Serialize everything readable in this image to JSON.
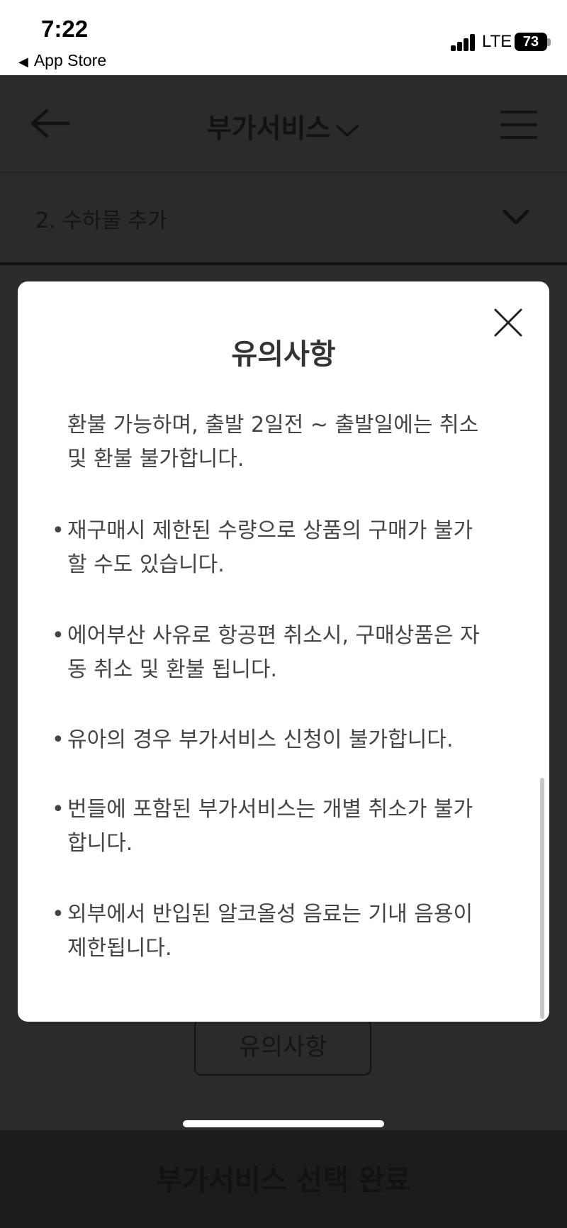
{
  "status_bar": {
    "time": "7:22",
    "back_app": "App Store",
    "network": "LTE",
    "battery": "73"
  },
  "header": {
    "title": "부가서비스"
  },
  "section": {
    "label": "2. 수하물 추가"
  },
  "modal": {
    "title": "유의사항",
    "intro_lines": [
      "환불 가능하며, 출발 2일전 ~ 출발일에는 취소",
      "및 환불 불가합니다."
    ],
    "items": [
      {
        "lines": [
          "재구매시 제한된 수량으로 상품의 구매가 불가",
          "할 수도 있습니다."
        ]
      },
      {
        "lines": [
          "에어부산 사유로 항공편 취소시, 구매상품은 자",
          "동 취소 및 환불 됩니다."
        ]
      },
      {
        "lines": [
          "유아의 경우 부가서비스 신청이 불가합니다."
        ]
      },
      {
        "lines": [
          "번들에 포함된 부가서비스는 개별 취소가 불가",
          "합니다."
        ]
      },
      {
        "lines": [
          "외부에서 반입된 알코올성 음료는 기내 음용이",
          "제한됩니다."
        ]
      }
    ],
    "bullet_glyph": "•"
  },
  "notice_button": {
    "label": "유의사항"
  },
  "bottom_bar": {
    "label": "부가서비스 선택 완료"
  }
}
